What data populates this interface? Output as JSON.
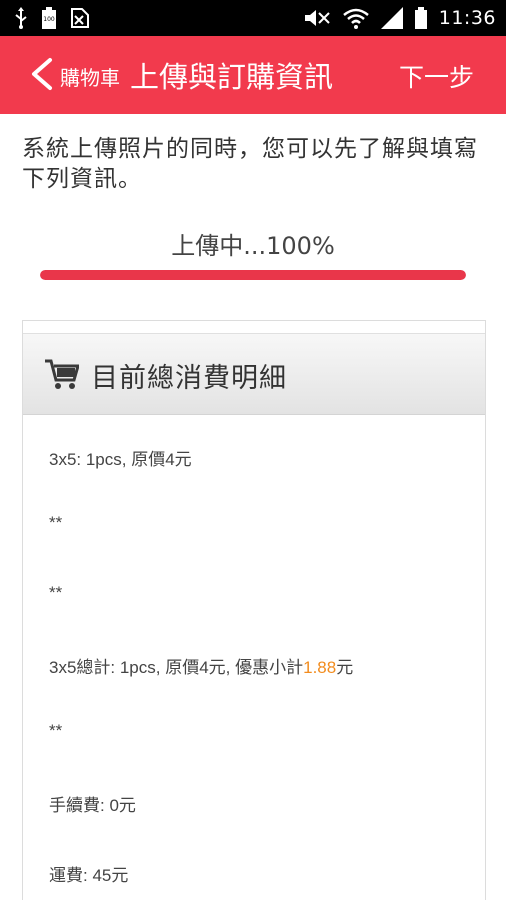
{
  "status_bar": {
    "time": "11:36",
    "icons": [
      "usb-icon",
      "sd-card-icon",
      "battery-100-icon",
      "no-sim-icon",
      "mute-icon",
      "wifi-icon",
      "signal-icon",
      "battery-icon"
    ],
    "battery_badge": "100"
  },
  "app_bar": {
    "back_icon": "chevron-left-icon",
    "breadcrumb": "購物車",
    "title": "上傳與訂購資訊",
    "next_label": "下一步",
    "color": "#f23a4d"
  },
  "intro": {
    "text": "系統上傳照片的同時，您可以先了解與填寫下列資訊。"
  },
  "upload": {
    "status_label": "上傳中...100%",
    "progress_percent": 100,
    "bar_color": "#e9364a"
  },
  "summary": {
    "icon": "cart-icon",
    "heading": "目前總消費明細",
    "lines": [
      "3x5: 1pcs, 原價4元",
      "**",
      "**",
      "**",
      "手續費: 0元",
      "運費: 45元"
    ],
    "subtotal": {
      "prefix": "3x5總計: 1pcs, 原價4元, 優惠小計",
      "amount": "1.88",
      "suffix": "元",
      "accent_color": "#f28c1e"
    }
  }
}
